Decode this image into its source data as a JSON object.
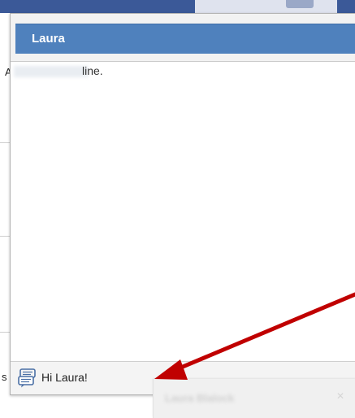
{
  "chat": {
    "contact_name": "Laura",
    "status_text": "line.",
    "message_input": "Hi Laura!"
  },
  "popup": {
    "title": "Laura Blalock",
    "close_icon": "close-icon"
  },
  "background": {
    "fragment_a": "A",
    "fragment_s": "s"
  },
  "annotation": {
    "arrow_color": "#c00000"
  },
  "colors": {
    "titlebar": "#4f81bd",
    "titlebar_text": "#ffffff"
  }
}
